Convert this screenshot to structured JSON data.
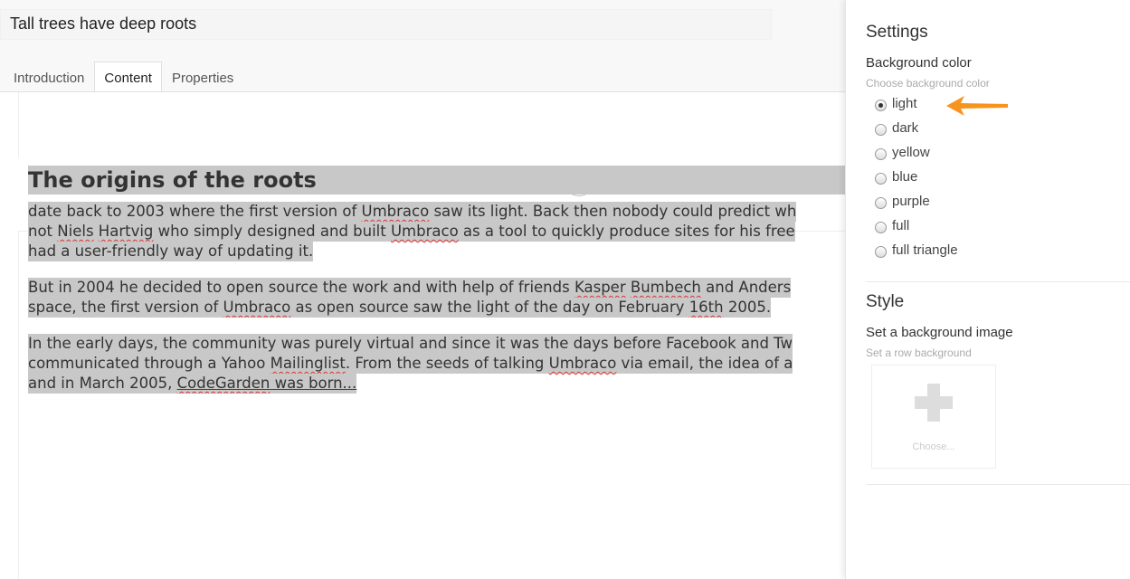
{
  "header": {
    "title_value": "Tall trees have deep roots",
    "tabs": [
      {
        "label": "Introduction",
        "active": false
      },
      {
        "label": "Content",
        "active": true
      },
      {
        "label": "Properties",
        "active": false
      }
    ]
  },
  "editor": {
    "add_button": "+",
    "heading": "The origins of the roots",
    "paragraphs": [
      {
        "lines": [
          "date back to 2003 where the first version of Umbraco saw its light. Back then nobody could predict wh",
          "not Niels Hartvig who simply designed and built Umbraco as a tool to quickly produce sites for his free",
          "had a user-friendly way of updating it."
        ]
      },
      {
        "lines": [
          "But in 2004 he decided to open source the work and with help of friends Kasper Bumbech and Anders",
          "space, the first version of Umbraco as open source saw the light of the day on February 16th 2005."
        ]
      },
      {
        "lines": [
          "In the early days, the community was purely virtual and since it was the days before Facebook and Tw",
          "communicated through a Yahoo Mailinglist. From the seeds of talking Umbraco via email, the idea of a",
          "and in March 2005, CodeGarden was born..."
        ]
      }
    ]
  },
  "settings": {
    "title": "Settings",
    "background_color": {
      "label": "Background color",
      "description": "Choose background color",
      "options": [
        "light",
        "dark",
        "yellow",
        "blue",
        "purple",
        "full",
        "full triangle"
      ],
      "selected": "light"
    },
    "style_title": "Style",
    "background_image": {
      "label": "Set a background image",
      "description": "Set a row background",
      "choose_label": "Choose..."
    }
  },
  "colors": {
    "arrow": "#f7941d",
    "selection": "#c8c8c8"
  }
}
